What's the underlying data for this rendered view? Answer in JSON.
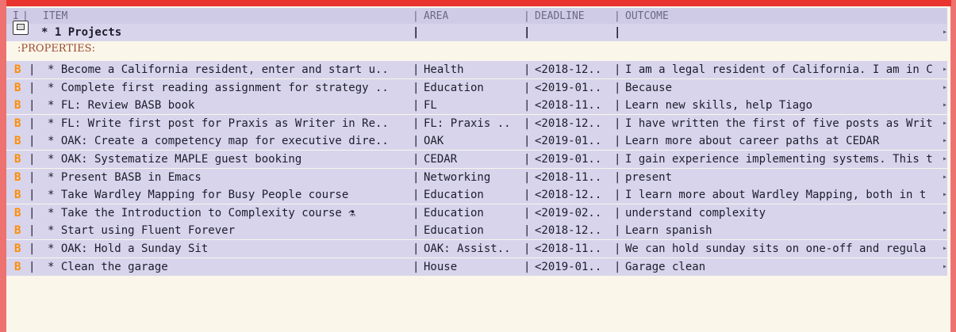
{
  "header": {
    "marker": "I",
    "item": "ITEM",
    "area": "AREA",
    "deadline": "DEADLINE",
    "outcome": "OUTCOME"
  },
  "projects_heading": "* 1 Projects",
  "properties_label": ":PROPERTIES:",
  "row_marker": "B",
  "rows": [
    {
      "item": "* Become a California resident, enter and start u..",
      "area": "Health",
      "deadline": "<2018-12..",
      "outcome": "I am a legal resident of California. I am in C"
    },
    {
      "item": "* Complete first reading assignment for strategy ..",
      "area": "Education",
      "deadline": "<2019-01..",
      "outcome": "Because"
    },
    {
      "item": "* FL: Review BASB book",
      "area": "FL",
      "deadline": "<2018-11..",
      "outcome": "Learn new skills, help Tiago"
    },
    {
      "item": "* FL: Write first post for Praxis as Writer in Re..",
      "area": "FL: Praxis ..",
      "deadline": "<2018-12..",
      "outcome": "I have written the first of five posts as Writ"
    },
    {
      "item": "* OAK: Create a competency map for executive dire..",
      "area": "OAK",
      "deadline": "<2019-01..",
      "outcome": "Learn more about career paths at CEDAR"
    },
    {
      "item": "* OAK: Systematize MAPLE guest booking",
      "area": "CEDAR",
      "deadline": "<2019-01..",
      "outcome": "I gain experience implementing systems. This t"
    },
    {
      "item": "* Present BASB in Emacs",
      "area": "Networking",
      "deadline": "<2018-11..",
      "outcome": "present"
    },
    {
      "item": "* Take Wardley Mapping for Busy People course",
      "area": "Education",
      "deadline": "<2018-12..",
      "outcome": "I learn more about Wardley Mapping, both in t"
    },
    {
      "item": "* Take the Introduction to Complexity course ⚗",
      "area": "Education",
      "deadline": "<2019-02..",
      "outcome": "understand complexity"
    },
    {
      "item": "* Start using Fluent Forever",
      "area": "Education",
      "deadline": "<2018-12..",
      "outcome": "Learn spanish"
    },
    {
      "item": "* OAK: Hold a Sunday Sit",
      "area": "OAK: Assist..",
      "deadline": "<2018-11..",
      "outcome": "We can hold sunday sits on one-off and regula"
    },
    {
      "item": "* Clean the garage",
      "area": "House",
      "deadline": "<2019-01..",
      "outcome": "Garage clean"
    }
  ],
  "continuation_glyph": "▸",
  "colors": {
    "frame": "#e8332f",
    "band": "#d7d4ec",
    "editor_bg": "#fbf6ea",
    "marker": "#ff8c00"
  }
}
